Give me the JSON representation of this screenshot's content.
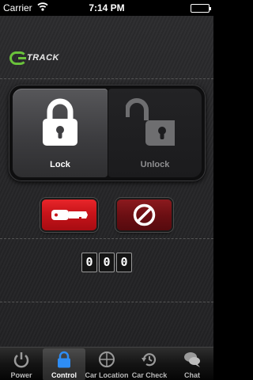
{
  "status_bar": {
    "carrier": "Carrier",
    "time": "7:14 PM",
    "battery_level": 1.0
  },
  "app": {
    "logo_text": "TRACK",
    "logo_letter": "G"
  },
  "panel": {
    "lock_label": "Lock",
    "unlock_label": "Unlock",
    "selected": "lock"
  },
  "actions": {
    "key_icon": "key-icon",
    "stop_icon": "no-entry-icon"
  },
  "counter": {
    "digits": [
      "0",
      "0",
      "0"
    ]
  },
  "tabs": [
    {
      "label": "Power",
      "icon": "power-icon"
    },
    {
      "label": "Control",
      "icon": "padlock-icon",
      "active": true
    },
    {
      "label": "Car Location",
      "icon": "crosshair-icon"
    },
    {
      "label": "Car Check",
      "icon": "history-icon"
    },
    {
      "label": "Chat",
      "icon": "chat-bubbles-icon"
    }
  ],
  "colors": {
    "brand_green": "#6ac23b",
    "accent_red": "#d0181d",
    "active_blue": "#2e8df5"
  }
}
